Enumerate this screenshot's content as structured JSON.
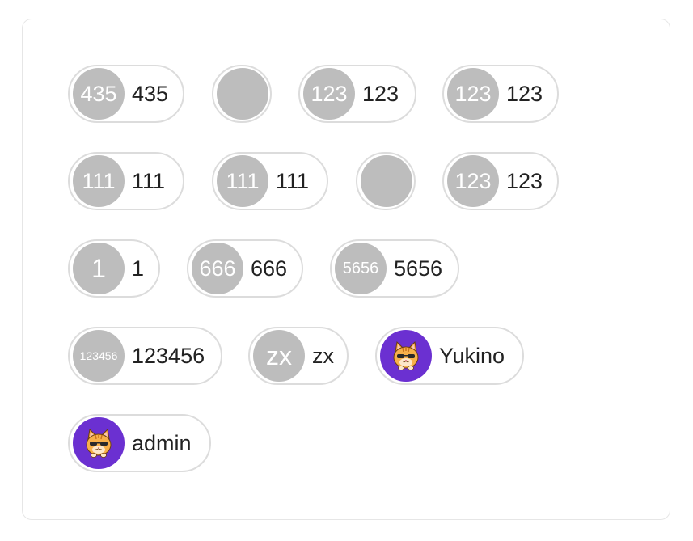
{
  "chips": [
    {
      "avatar_text": "435",
      "label": "435"
    },
    {
      "avatar_text": "",
      "label": ""
    },
    {
      "avatar_text": "123",
      "label": "123"
    },
    {
      "avatar_text": "123",
      "label": "123"
    },
    {
      "avatar_text": "111",
      "label": "111"
    },
    {
      "avatar_text": "111",
      "label": "111"
    },
    {
      "avatar_text": "",
      "label": ""
    },
    {
      "avatar_text": "123",
      "label": "123"
    },
    {
      "avatar_text": "1",
      "label": "1"
    },
    {
      "avatar_text": "666",
      "label": "666"
    },
    {
      "avatar_text": "5656",
      "label": "5656"
    },
    {
      "avatar_text": "123456",
      "label": "123456"
    },
    {
      "avatar_text": "zx",
      "label": "zx"
    },
    {
      "avatar_text": "",
      "label": "Yukino",
      "avatar_icon": "cat-sunglasses-icon"
    },
    {
      "avatar_text": "",
      "label": "admin",
      "avatar_icon": "cat-sunglasses-icon"
    }
  ],
  "colors": {
    "avatar_default": "#bdbdbd",
    "avatar_image_bg": "#6b30d1",
    "chip_border": "#dcdcdc"
  }
}
